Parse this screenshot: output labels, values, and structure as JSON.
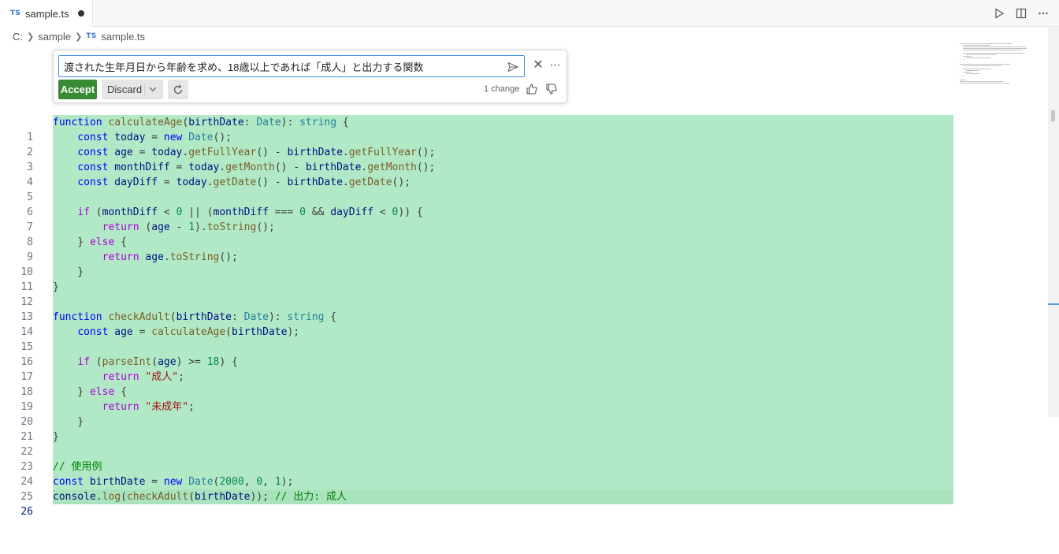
{
  "tab": {
    "badge": "TS",
    "filename": "sample.ts"
  },
  "breadcrumb": {
    "drive": "C:",
    "folder": "sample",
    "badge": "TS",
    "file": "sample.ts"
  },
  "inline_chat": {
    "prompt": "渡された生年月日から年齢を求め、18歳以上であれば「成人」と出力する関数",
    "accept_label": "Accept",
    "discard_label": "Discard",
    "change_count": "1 change"
  },
  "editor": {
    "current_line": 26,
    "highlight_color": "#b1e9c6",
    "lines": [
      {
        "n": "1"
      },
      {
        "n": "2"
      },
      {
        "n": "3"
      },
      {
        "n": "4"
      },
      {
        "n": "5"
      },
      {
        "n": "6"
      },
      {
        "n": "7"
      },
      {
        "n": "8"
      },
      {
        "n": "9"
      },
      {
        "n": "10"
      },
      {
        "n": "11"
      },
      {
        "n": "12"
      },
      {
        "n": "13"
      },
      {
        "n": "14"
      },
      {
        "n": "15"
      },
      {
        "n": "16"
      },
      {
        "n": "17"
      },
      {
        "n": "18"
      },
      {
        "n": "19"
      },
      {
        "n": "20"
      },
      {
        "n": "21"
      },
      {
        "n": "22"
      },
      {
        "n": "23"
      },
      {
        "n": "24"
      },
      {
        "n": "25"
      },
      {
        "n": "26"
      }
    ],
    "tokens": {
      "function": "function",
      "const": "const",
      "new": "new",
      "return": "return",
      "if": "if",
      "else": "else",
      "calculateAge": "calculateAge",
      "checkAdult": "checkAdult",
      "birthDate": "birthDate",
      "Date": "Date",
      "string": "string",
      "today": "today",
      "age": "age",
      "monthDiff": "monthDiff",
      "dayDiff": "dayDiff",
      "getFullYear": "getFullYear",
      "getMonth": "getMonth",
      "getDate": "getDate",
      "toString": "toString",
      "parseInt": "parseInt",
      "console": "console",
      "log": "log",
      "zero": "0",
      "one": "1",
      "eighteen": "18",
      "y2000": "2000",
      "adult_str": "\"成人\"",
      "minor_str": "\"未成年\"",
      "comment_usage": "// 使用例",
      "comment_output": "// 出力: 成人"
    }
  }
}
